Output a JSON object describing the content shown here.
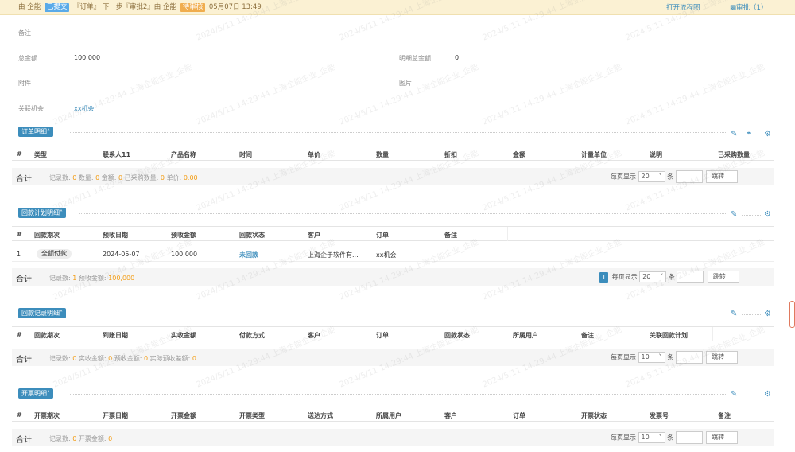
{
  "topbar": {
    "by1": "由",
    "user1": "企能",
    "status1": "已提交",
    "step_text": "『订单』 下一步『审批2』由",
    "user2": "企能",
    "status2": "待审核",
    "time": "05月07日 13:49",
    "open_flow": "打开流程图",
    "approve": "审批（1）"
  },
  "fields": {
    "remark_label": "备注",
    "total_label": "总金额",
    "total_value": "100,000",
    "detail_total_label": "明细总金额",
    "detail_total_value": "0",
    "attach_label": "附件",
    "image_label": "图片",
    "opportunity_label": "关联机会",
    "opportunity_value": "xx机会"
  },
  "sections": {
    "order": {
      "title": "订单明细",
      "headers": [
        "#",
        "类型",
        "联系人11",
        "产品名称",
        "时间",
        "单价",
        "数量",
        "折扣",
        "金额",
        "计量单位",
        "说明",
        "已采购数量"
      ],
      "sum_label": "合计",
      "sum_parts": {
        "l1": "记录数:",
        "v1": "0",
        "l2": "数量:",
        "v2": "0",
        "l3": "金额:",
        "v3": "0",
        "l4": "已采购数量:",
        "v4": "0",
        "l5": "单价:",
        "v5": "0.00"
      },
      "pager": {
        "per_page": "每页显示",
        "size": "20",
        "unit": "条",
        "jump": "跳转"
      }
    },
    "plan": {
      "title": "回款计划明细",
      "headers": [
        "#",
        "回款期次",
        "预收日期",
        "预收金额",
        "回款状态",
        "客户",
        "订单",
        "备注"
      ],
      "rows": [
        {
          "idx": "1",
          "period": "全额付款",
          "date": "2024-05-07",
          "amount": "100,000",
          "status": "未回款",
          "customer": "上海企于软件有...",
          "order": "xx机会"
        }
      ],
      "sum_label": "合计",
      "sum_parts": {
        "l1": "记录数:",
        "v1": "1",
        "l2": "预收金额:",
        "v2": "100,000"
      },
      "pager": {
        "page": "1",
        "per_page": "每页显示",
        "size": "20",
        "unit": "条",
        "jump": "跳转"
      }
    },
    "record": {
      "title": "回款记录明细",
      "headers": [
        "#",
        "回款期次",
        "到账日期",
        "实收金额",
        "付款方式",
        "客户",
        "订单",
        "回款状态",
        "所属用户",
        "备注",
        "关联回款计划"
      ],
      "sum_label": "合计",
      "sum_parts": {
        "l1": "记录数:",
        "v1": "0",
        "l2": "实收金额:",
        "v2": "0",
        "l3": "预收金额:",
        "v3": "0",
        "l4": "实际预收差额:",
        "v4": "0"
      },
      "pager": {
        "per_page": "每页显示",
        "size": "10",
        "unit": "条",
        "jump": "跳转"
      }
    },
    "invoice": {
      "title": "开票明细",
      "headers": [
        "#",
        "开票期次",
        "开票日期",
        "开票金额",
        "开票类型",
        "送达方式",
        "所属用户",
        "客户",
        "订单",
        "开票状态",
        "发票号",
        "备注"
      ],
      "sum_label": "合计",
      "sum_parts": {
        "l1": "记录数:",
        "v1": "0",
        "l2": "开票金额:",
        "v2": "0"
      },
      "pager": {
        "per_page": "每页显示",
        "size": "10",
        "unit": "条",
        "jump": "跳转"
      }
    }
  },
  "watermark": "2024/5/11 14:29:44 上海企能企业_企能",
  "icons": {
    "edit": "pencil-icon",
    "toggle": "toggle-icon",
    "settings": "gear-icon"
  },
  "colors": {
    "primary": "#3c8dbc",
    "warning": "#f0ad4e",
    "topbar": "#fbf1d3"
  }
}
